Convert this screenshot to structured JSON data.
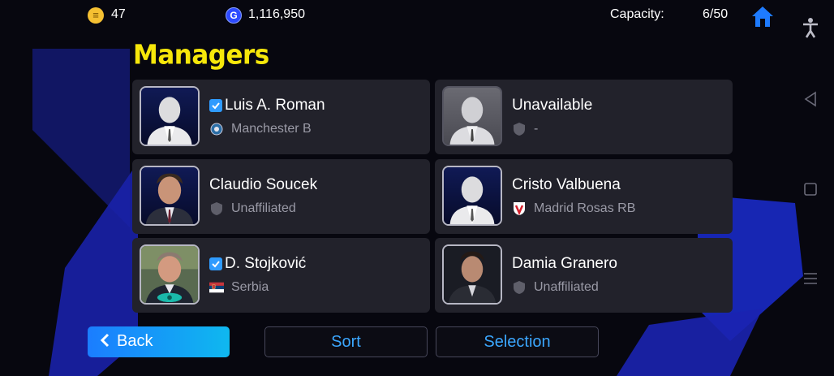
{
  "topbar": {
    "coins_icon": "efootball-coin-icon",
    "coins": "47",
    "gp_icon": "gp-icon",
    "gp_letter": "G",
    "gp": "1,116,950",
    "capacity_label": "Capacity:",
    "capacity_value": "6/50",
    "home_icon": "home-icon"
  },
  "system_nav": [
    "accessibility-icon",
    "back-triangle-icon",
    "recents-square-icon",
    "menu-lines-icon"
  ],
  "page": {
    "title": "Managers"
  },
  "managers": [
    {
      "name": "Luis A. Roman",
      "club": "Manchester B",
      "verified": true,
      "avatar": "silhouette-portrait",
      "club_icon": "club-crest-icon"
    },
    {
      "name": "Unavailable",
      "club": "-",
      "verified": false,
      "avatar": "silhouette-portrait-grey",
      "club_icon": "shield-icon"
    },
    {
      "name": "Claudio Soucek",
      "club": "Unaffiliated",
      "verified": false,
      "avatar": "manager-photo",
      "club_icon": "shield-icon"
    },
    {
      "name": "Cristo Valbuena",
      "club": "Madrid Rosas RB",
      "verified": false,
      "avatar": "silhouette-portrait",
      "club_icon": "club-crest-icon"
    },
    {
      "name": "D. Stojković",
      "club": "Serbia",
      "verified": true,
      "avatar": "manager-photo",
      "club_icon": "serbia-flag-icon"
    },
    {
      "name": "Damia Granero",
      "club": "Unaffiliated",
      "verified": false,
      "avatar": "manager-photo",
      "club_icon": "shield-icon"
    }
  ],
  "buttons": {
    "back": "Back",
    "sort": "Sort",
    "selection": "Selection"
  },
  "colors": {
    "title": "#f6e70a",
    "accent": "#3ba7ff",
    "back_gradient_start": "#1b7dff",
    "back_gradient_end": "#0fb8ef",
    "card": "#22222b"
  }
}
